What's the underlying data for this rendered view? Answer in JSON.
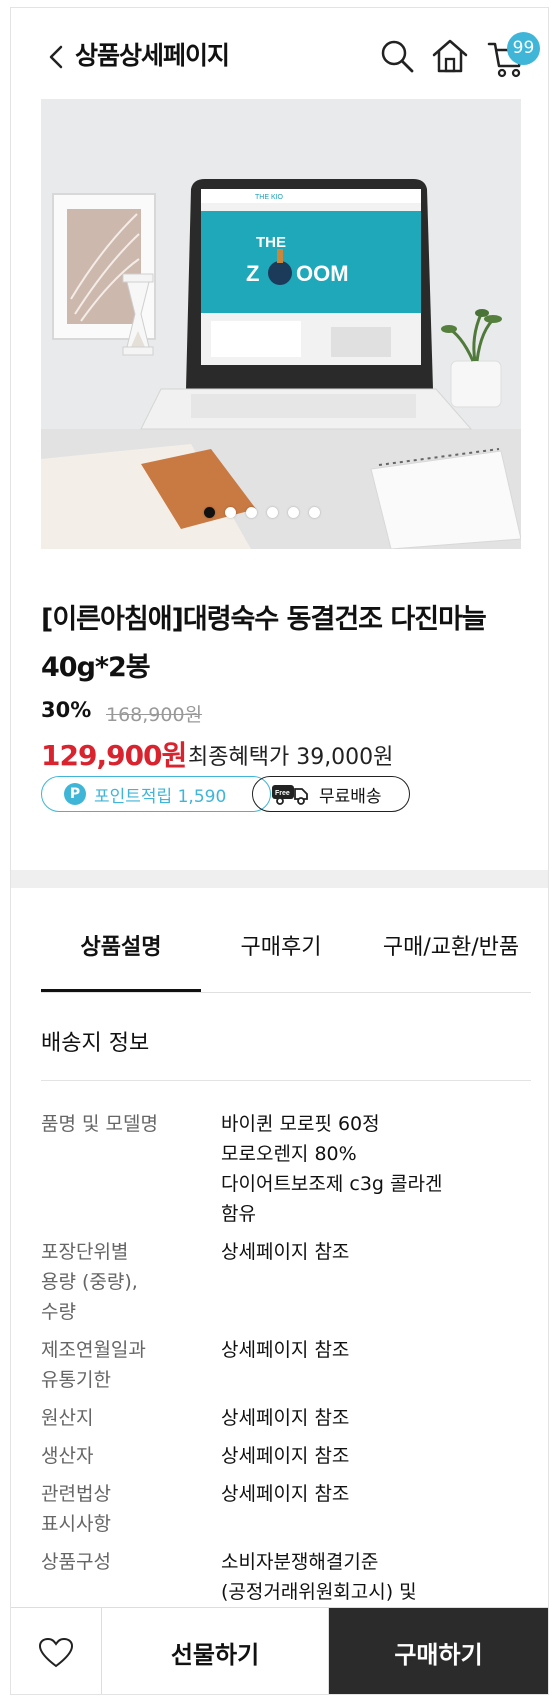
{
  "header": {
    "title": "상품상세페이지",
    "cart_count": "99"
  },
  "hero": {
    "screen_brand": "THE KIO",
    "screen_headline": "THE ZOOOM",
    "slide_count": 6,
    "active_slide": 1
  },
  "product": {
    "title": "[이른아침애]대령숙수 동결건조 다진마늘 40g*2봉",
    "discount": "30%",
    "original_price": "168,900원",
    "sale_price": "129,900원",
    "final_benefit": "최종혜택가 39,000원",
    "point_icon_label": "P",
    "point_label": "포인트적립 1,590",
    "shipping_icon_label": "Free",
    "shipping_label": "무료배송"
  },
  "tabs": [
    {
      "label": "상품설명",
      "active": true
    },
    {
      "label": "구매후기",
      "active": false
    },
    {
      "label": "구매/교환/반품",
      "active": false
    }
  ],
  "delivery": {
    "title": "배송지 정보",
    "rows": [
      {
        "label": "품명 및 모델명",
        "value": "바이퀸 모로핏 60정\n모로오렌지 80%\n다이어트보조제 c3g 콜라겐\n함유"
      },
      {
        "label": "포장단위별\n용량 (중량),\n수량",
        "value": "상세페이지 참조"
      },
      {
        "label": "제조연월일과\n유통기한",
        "value": "상세페이지 참조"
      },
      {
        "label": "원산지",
        "value": "상세페이지 참조"
      },
      {
        "label": "생산자",
        "value": "상세페이지 참조"
      },
      {
        "label": "관련법상\n표시사항",
        "value": "상세페이지 참조"
      },
      {
        "label": "상품구성",
        "value": "소비자분쟁해결기준\n(공정거래위원회고시) 및"
      }
    ]
  },
  "bottom_bar": {
    "gift_label": "선물하기",
    "buy_label": "구매하기"
  },
  "colors": {
    "accent": "#3fb6d8",
    "sale_red": "#d9232e",
    "buy_button": "#2b2b2b"
  }
}
